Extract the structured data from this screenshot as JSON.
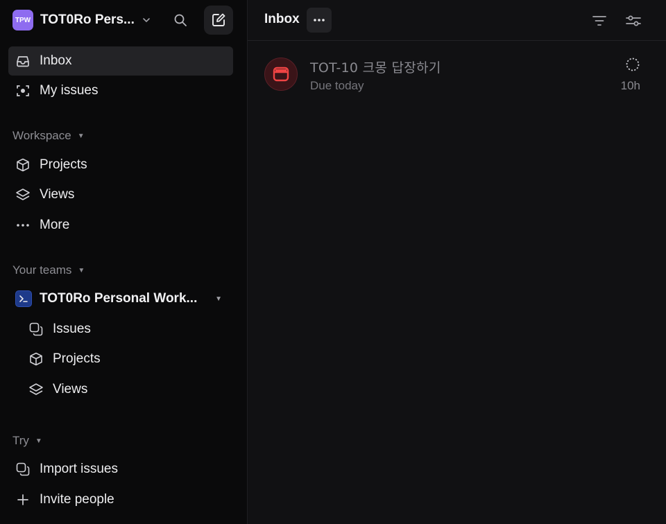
{
  "workspace": {
    "avatar_initials": "TPW",
    "name": "TOT0Ro Pers...",
    "avatar_color": "#8e6cf0"
  },
  "nav": {
    "inbox": "Inbox",
    "my_issues": "My issues"
  },
  "workspace_section": {
    "label": "Workspace",
    "items": [
      "Projects",
      "Views",
      "More"
    ]
  },
  "teams_section": {
    "label": "Your teams",
    "team_name": "TOT0Ro Personal Work...",
    "items": [
      "Issues",
      "Projects",
      "Views"
    ]
  },
  "try_section": {
    "label": "Try",
    "items": [
      "Import issues",
      "Invite people"
    ]
  },
  "main": {
    "title": "Inbox",
    "notifications": [
      {
        "title": "TOT-10 크몽 답장하기",
        "subtitle": "Due today",
        "time": "10h",
        "icon": "calendar-icon",
        "accent_color": "#ef4444"
      }
    ]
  }
}
